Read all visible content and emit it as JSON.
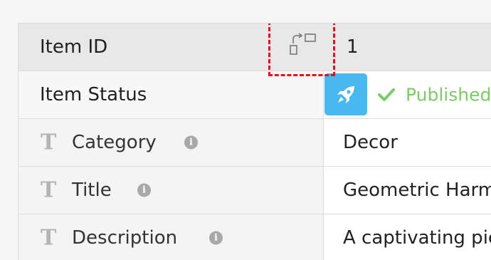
{
  "item": {
    "id_label": "Item ID",
    "id_value": "1",
    "status_label": "Item Status",
    "status_value": "Published",
    "status_color": "#7ccb66",
    "rocket_color": "#48b8ee",
    "highlight_color": "#e0141e"
  },
  "fields": [
    {
      "type_icon": "T",
      "label": "Category",
      "value": "Decor",
      "info": "i"
    },
    {
      "type_icon": "T",
      "label": "Title",
      "value": "Geometric Harmony",
      "info": "i"
    },
    {
      "type_icon": "T",
      "label": "Description",
      "value": "A captivating piece",
      "info": "i"
    }
  ],
  "icons": {
    "swap": "swap-columns-icon",
    "rocket": "rocket-icon",
    "check": "check-icon",
    "text_type": "text-type-icon",
    "info": "info-icon"
  }
}
